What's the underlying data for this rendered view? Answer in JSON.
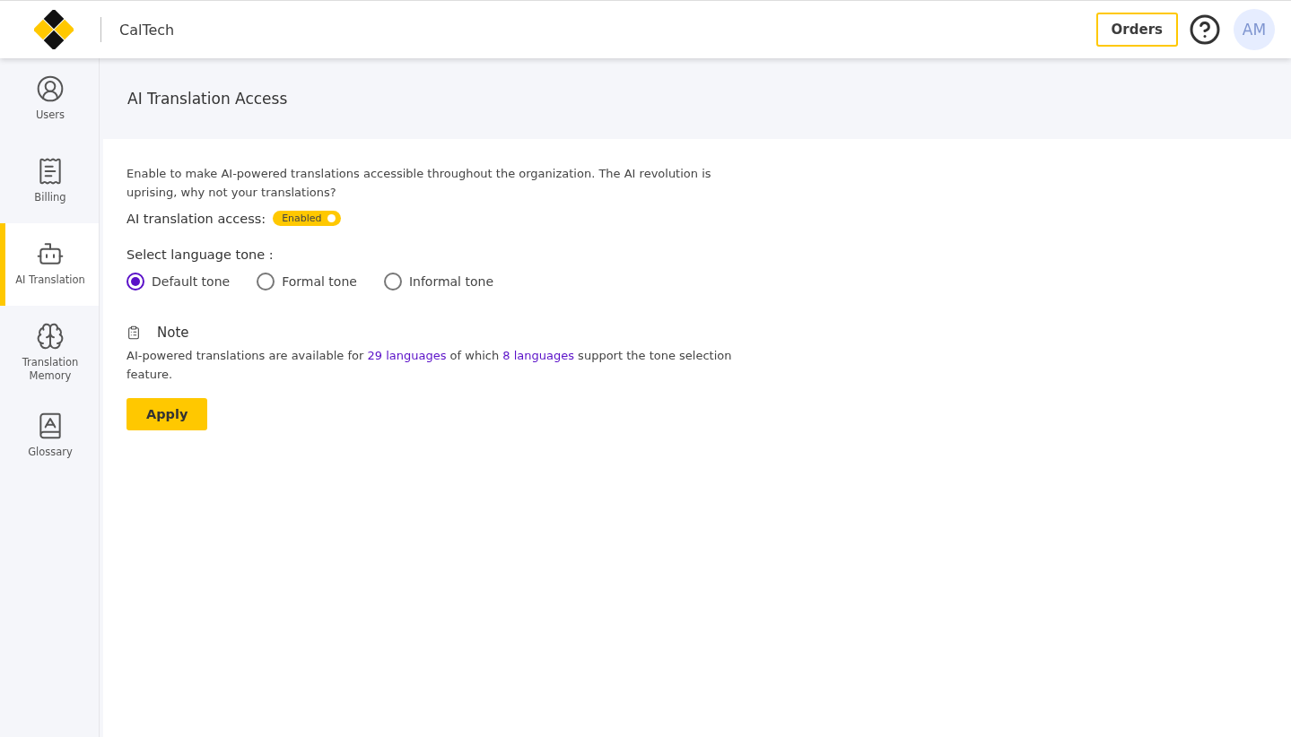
{
  "header": {
    "brand": "CalTech",
    "orders_button": "Orders",
    "avatar_initials": "AM"
  },
  "sidebar": {
    "items": [
      {
        "label": "Users",
        "selected": false
      },
      {
        "label": "Billing",
        "selected": false
      },
      {
        "label": "AI Translation",
        "selected": true
      },
      {
        "label": "Translation Memory",
        "selected": false
      },
      {
        "label": "Glossary",
        "selected": false
      }
    ]
  },
  "page": {
    "title": "AI Translation Access",
    "description": "Enable to make AI-powered translations accessible throughout the organization. The AI revolution is uprising, why not your translations?",
    "access": {
      "label": "AI translation access:",
      "toggle_label": "Enabled",
      "on": true
    },
    "tone": {
      "label": "Select language tone :",
      "options": [
        {
          "label": "Default tone",
          "selected": true
        },
        {
          "label": "Formal tone",
          "selected": false
        },
        {
          "label": "Informal tone",
          "selected": false
        }
      ]
    },
    "note": {
      "title": "Note",
      "parts": [
        {
          "kind": "text",
          "text": "AI-powered translations are available for "
        },
        {
          "kind": "link",
          "text": "29 languages"
        },
        {
          "kind": "text",
          "text": " of which "
        },
        {
          "kind": "link",
          "text": "8 languages"
        },
        {
          "kind": "text",
          "text": " support the tone selection feature."
        }
      ]
    },
    "apply_button": "Apply"
  }
}
